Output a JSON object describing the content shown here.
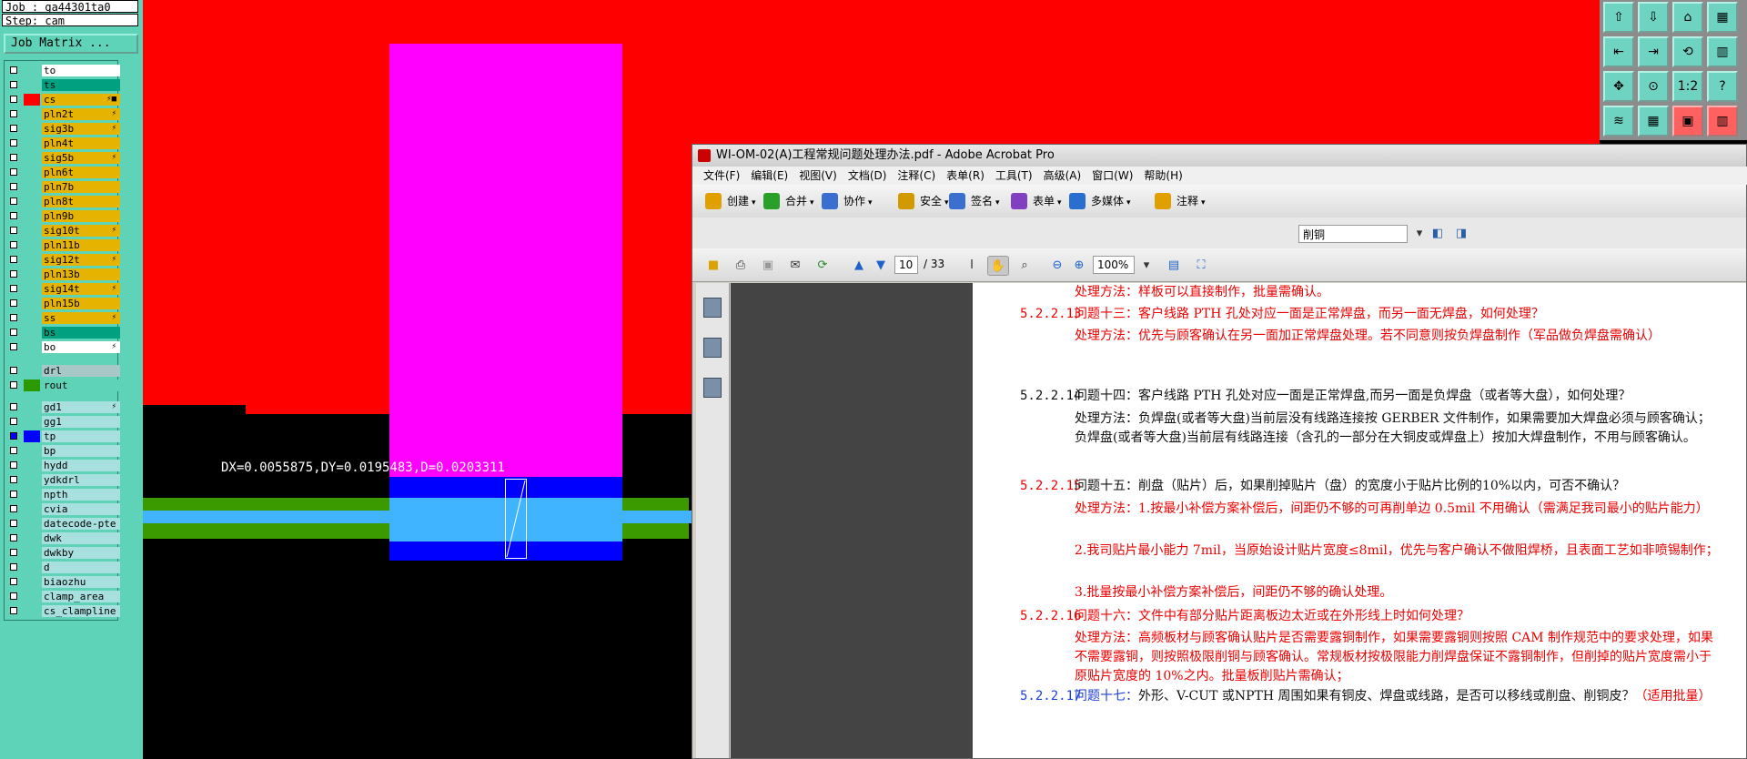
{
  "left_panel": {
    "job_label": "Job : ga44301ta0",
    "step_label": "Step: cam",
    "job_matrix_button": "Job Matrix ...",
    "layers": [
      {
        "name": "to",
        "color": "#ffffff",
        "check": false,
        "tag": ""
      },
      {
        "name": "ts",
        "color": "#00a080",
        "check": false,
        "tag": ""
      },
      {
        "name": "cs",
        "color": "#e6b400",
        "check": false,
        "tag": "⚡■",
        "swatch": "#ff0000"
      },
      {
        "name": "pln2t",
        "color": "#e6b400",
        "check": false,
        "tag": "⚡"
      },
      {
        "name": "sig3b",
        "color": "#e6b400",
        "check": false,
        "tag": "⚡"
      },
      {
        "name": "pln4t",
        "color": "#e6b400",
        "check": false,
        "tag": ""
      },
      {
        "name": "sig5b",
        "color": "#e6b400",
        "check": false,
        "tag": "⚡"
      },
      {
        "name": "pln6t",
        "color": "#e6b400",
        "check": false,
        "tag": ""
      },
      {
        "name": "pln7b",
        "color": "#e6b400",
        "check": false,
        "tag": ""
      },
      {
        "name": "pln8t",
        "color": "#e6b400",
        "check": false,
        "tag": ""
      },
      {
        "name": "pln9b",
        "color": "#e6b400",
        "check": false,
        "tag": ""
      },
      {
        "name": "sig10t",
        "color": "#e6b400",
        "check": false,
        "tag": "⚡"
      },
      {
        "name": "pln11b",
        "color": "#e6b400",
        "check": false,
        "tag": ""
      },
      {
        "name": "sig12t",
        "color": "#e6b400",
        "check": false,
        "tag": "⚡"
      },
      {
        "name": "pln13b",
        "color": "#e6b400",
        "check": false,
        "tag": ""
      },
      {
        "name": "sig14t",
        "color": "#e6b400",
        "check": false,
        "tag": "⚡"
      },
      {
        "name": "pln15b",
        "color": "#e6b400",
        "check": false,
        "tag": ""
      },
      {
        "name": "ss",
        "color": "#e6b400",
        "check": false,
        "tag": "⚡"
      },
      {
        "name": "bs",
        "color": "#00a080",
        "check": false,
        "tag": ""
      },
      {
        "name": "bo",
        "color": "#ffffff",
        "check": false,
        "tag": "⚡"
      }
    ],
    "drill_layers": [
      {
        "name": "drl",
        "color": "#a8c8c8",
        "check": false,
        "tag": ""
      },
      {
        "name": "rout",
        "color": "#5fd3b8",
        "check": false,
        "tag": "",
        "swatch": "#2a9a00"
      }
    ],
    "misc_layers": [
      {
        "name": "gd1",
        "color": "#a8e0e0",
        "check": false,
        "tag": "⚡"
      },
      {
        "name": "gg1",
        "color": "#a8e0e0",
        "check": false,
        "tag": ""
      },
      {
        "name": "tp",
        "color": "#a8e0e0",
        "check": true,
        "tag": "",
        "swatch": "#0000ff"
      },
      {
        "name": "bp",
        "color": "#a8e0e0",
        "check": false,
        "tag": ""
      },
      {
        "name": "hydd",
        "color": "#a8e0e0",
        "check": false,
        "tag": ""
      },
      {
        "name": "ydkdrl",
        "color": "#a8e0e0",
        "check": false,
        "tag": ""
      },
      {
        "name": "npth",
        "color": "#a8e0e0",
        "check": false,
        "tag": ""
      },
      {
        "name": "cvia",
        "color": "#a8e0e0",
        "check": false,
        "tag": ""
      },
      {
        "name": "datecode-pte",
        "color": "#a8e0e0",
        "check": false,
        "tag": ""
      },
      {
        "name": "dwk",
        "color": "#a8e0e0",
        "check": false,
        "tag": ""
      },
      {
        "name": "dwkby",
        "color": "#a8e0e0",
        "check": false,
        "tag": ""
      },
      {
        "name": "d",
        "color": "#a8e0e0",
        "check": false,
        "tag": ""
      },
      {
        "name": "biaozhu",
        "color": "#a8e0e0",
        "check": false,
        "tag": ""
      },
      {
        "name": "clamp_area",
        "color": "#a8e0e0",
        "check": false,
        "tag": ""
      },
      {
        "name": "cs_clampline",
        "color": "#a8e0e0",
        "check": false,
        "tag": ""
      }
    ]
  },
  "canvas": {
    "measure_text": "DX=0.0055875,DY=0.0195483,D=0.0203311",
    "colors": {
      "copper": "#ff0000",
      "pad": "#ff00ff",
      "trace_blue": "#0000ff",
      "trace_light": "#40b4ff",
      "green": "#3a9a00"
    }
  },
  "right_toolbar": {
    "buttons": [
      "home-icon",
      "save-icon",
      "house-icon",
      "grid-icon",
      "left-icon",
      "right-icon",
      "loop-icon",
      "panel-icon",
      "zoom-fit-icon",
      "zoom-icon",
      "ratio-label",
      "help-icon",
      "layers-icon",
      "table-icon",
      "snap-icon",
      "measure-icon"
    ],
    "ratio_text": "1:2",
    "help_text": "?"
  },
  "acrobat": {
    "title": "WI-OM-02(A)工程常规问题处理办法.pdf - Adobe Acrobat Pro",
    "menus": [
      "文件(F)",
      "编辑(E)",
      "视图(V)",
      "文档(D)",
      "注释(C)",
      "表单(R)",
      "工具(T)",
      "高级(A)",
      "窗口(W)",
      "帮助(H)"
    ],
    "tasks": [
      "创建",
      "合并",
      "协作",
      "安全",
      "签名",
      "表单",
      "多媒体",
      "注释"
    ],
    "find_text": "削铜",
    "page_current": "10",
    "page_total": "/ 33",
    "zoom": "100%",
    "doc": {
      "p0": {
        "text": "处理方法：样板可以直接制作，批量需确认。"
      },
      "p13": {
        "num": "5.2.2.13",
        "q": "问题十三：客户线路 PTH 孔处对应一面是正常焊盘，而另一面无焊盘，如何处理？",
        "a": "处理方法：优先与顾客确认在另一面加正常焊盘处理。若不同意则按负焊盘制作（军品做负焊盘需确认）"
      },
      "p14": {
        "num": "5.2.2.14",
        "q": "问题十四：客户线路 PTH 孔处对应一面是正常焊盘,而另一面是负焊盘（或者等大盘），如何处理？",
        "a": "处理方法：负焊盘(或者等大盘)当前层没有线路连接按 GERBER 文件制作，如果需要加大焊盘必须与顾客确认；负焊盘(或者等大盘)当前层有线路连接（含孔的一部分在大铜皮或焊盘上）按加大焊盘制作，不用与顾客确认。"
      },
      "p15": {
        "num": "5.2.2.15",
        "q": "问题十五：削盘（贴片）后，如果削掉贴片（盘）的宽度小于贴片比例的10%以内，可否不确认？",
        "a1": "处理方法：1.按最小补偿方案补偿后，间距仍不够的可再削单边 0.5mil 不用确认（需满足我司最小的贴片能力）",
        "a2": "2.我司贴片最小能力 7mil，当原始设计贴片宽度≤8mil，优先与客户确认不做阻焊桥，且表面工艺如非喷锡制作；",
        "a3": "3.批量按最小补偿方案补偿后，间距仍不够的确认处理。"
      },
      "p16": {
        "num": "5.2.2.16",
        "q": "问题十六：文件中有部分贴片距离板边太近或在外形线上时如何处理？",
        "a": "处理方法：高频板材与顾客确认贴片是否需要露铜制作，如果需要露铜则按照 CAM 制作规范中的要求处理，如果不需要露铜，则按照极限削铜与顾客确认。常规板材按极限能力削焊盘保证不露铜制作，但削掉的贴片宽度需小于原贴片宽度的 10%之内。批量板削贴片需确认；"
      },
      "p17": {
        "num": "5.2.2.17",
        "q": "问题十七：",
        "q2": "外形、V-CUT 或NPTH 周围如果有铜皮、焊盘或线路，是否可以移线或削盘、削铜皮？",
        "q3": "（适用批量）"
      }
    }
  }
}
